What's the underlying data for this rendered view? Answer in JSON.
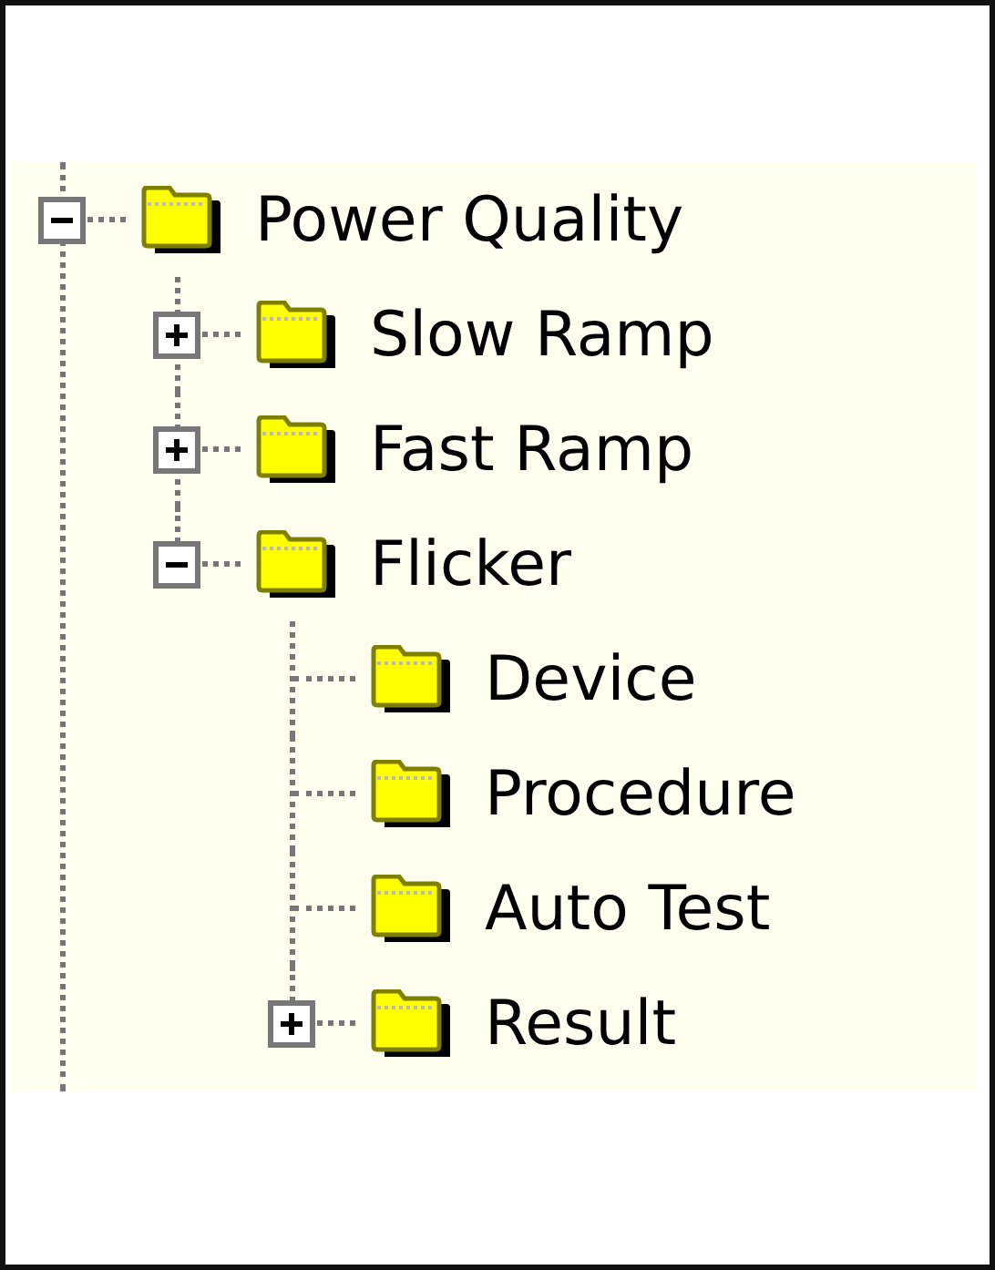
{
  "tree": [
    {
      "label": "Power Quality",
      "expanded": true,
      "children": [
        {
          "label": "Slow Ramp",
          "expanded": false
        },
        {
          "label": "Fast Ramp",
          "expanded": false
        },
        {
          "label": "Flicker",
          "expanded": true,
          "children": [
            {
              "label": "Device"
            },
            {
              "label": "Procedure"
            },
            {
              "label": "Auto Test"
            },
            {
              "label": "Result",
              "expanded": false
            }
          ]
        }
      ]
    }
  ]
}
